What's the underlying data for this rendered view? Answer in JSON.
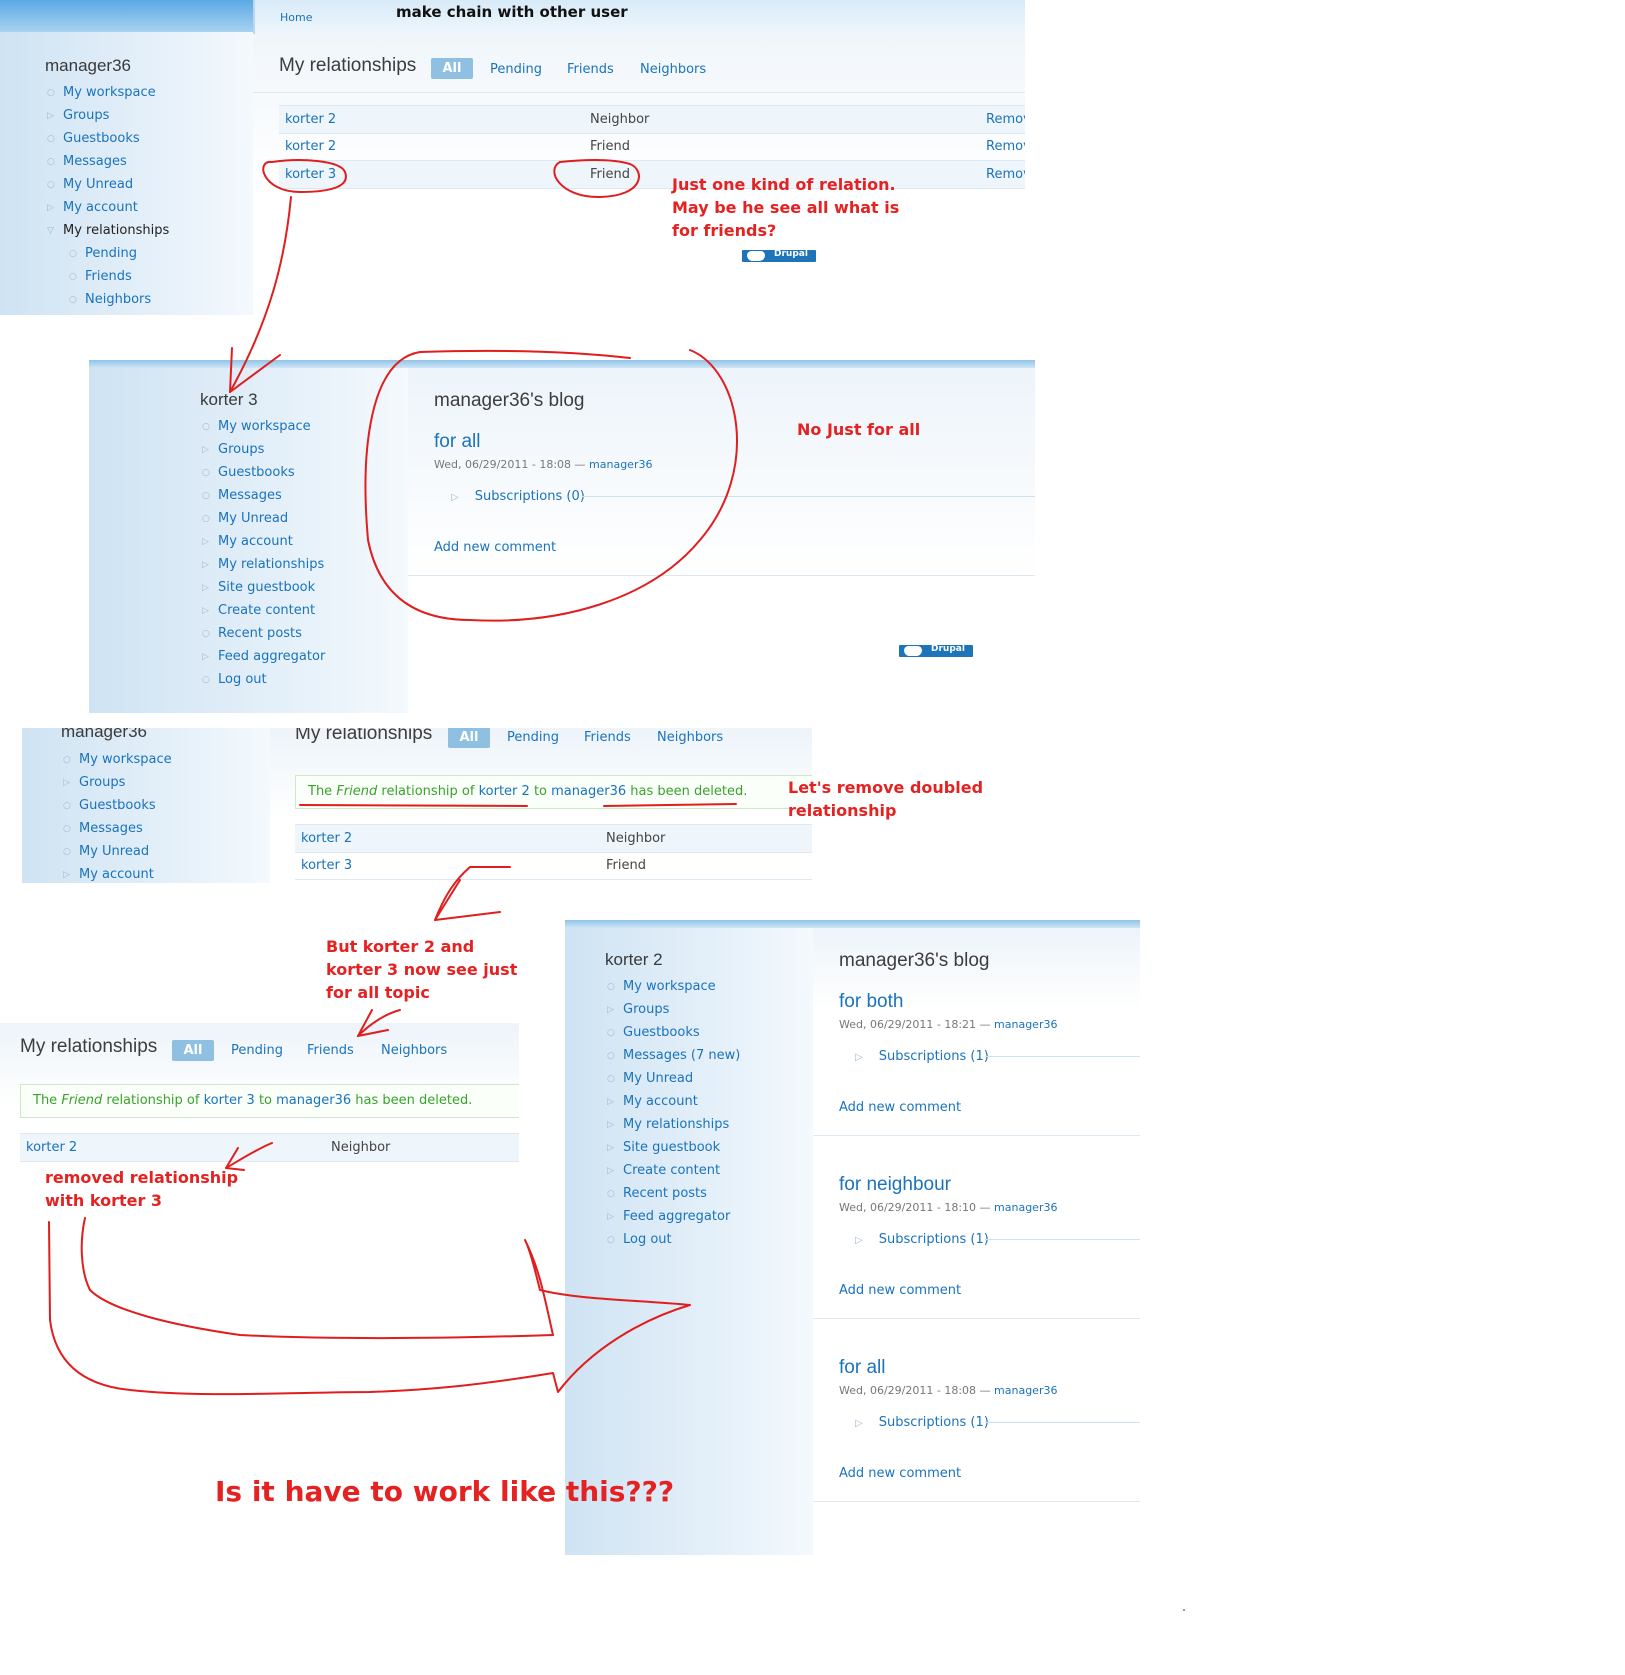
{
  "captions": {
    "top": "make chain with other user"
  },
  "panel1": {
    "breadcrumb": "Home",
    "sidebar_title": "manager36",
    "nav": [
      "My workspace",
      "Groups",
      "Guestbooks",
      "Messages",
      "My Unread",
      "My account",
      "My relationships",
      "Pending",
      "Friends",
      "Neighbors"
    ],
    "page_title": "My relationships",
    "tabs": [
      "All",
      "Pending",
      "Friends",
      "Neighbors"
    ],
    "rows": [
      {
        "user": "korter 2",
        "type": "Neighbor",
        "action": "Remov"
      },
      {
        "user": "korter 2",
        "type": "Friend",
        "action": "Remov"
      },
      {
        "user": "korter 3",
        "type": "Friend",
        "action": "Remov"
      }
    ],
    "badge": "Drupal"
  },
  "panel2": {
    "sidebar_title": "korter 3",
    "nav": [
      "My workspace",
      "Groups",
      "Guestbooks",
      "Messages",
      "My Unread",
      "My account",
      "My relationships",
      "Site guestbook",
      "Create content",
      "Recent posts",
      "Feed aggregator",
      "Log out"
    ],
    "blog_title": "manager36's blog",
    "node": {
      "title": "for all",
      "meta_date": "Wed, 06/29/2011 - 18:08 — ",
      "meta_author": "manager36",
      "subscriptions": "Subscriptions (0)",
      "add_comment": "Add new comment"
    },
    "badge": "Drupal"
  },
  "panel3": {
    "sidebar_title": "manager36",
    "nav": [
      "My workspace",
      "Groups",
      "Guestbooks",
      "Messages",
      "My Unread",
      "My account"
    ],
    "page_title": "My relationships",
    "tabs": [
      "All",
      "Pending",
      "Friends",
      "Neighbors"
    ],
    "message": {
      "p1": "The ",
      "rel": "Friend",
      "p2": " relationship of ",
      "user": "korter 2",
      "p3": " to ",
      "owner": "manager36",
      "p4": " has been deleted."
    },
    "rows": [
      {
        "user": "korter 2",
        "type": "Neighbor"
      },
      {
        "user": "korter 3",
        "type": "Friend"
      }
    ]
  },
  "panel4": {
    "page_title": "My relationships",
    "tabs": [
      "All",
      "Pending",
      "Friends",
      "Neighbors"
    ],
    "message": {
      "p1": "The ",
      "rel": "Friend",
      "p2": " relationship of ",
      "user": "korter 3",
      "p3": " to ",
      "owner": "manager36",
      "p4": " has been deleted."
    },
    "rows": [
      {
        "user": "korter 2",
        "type": "Neighbor"
      }
    ]
  },
  "panel5": {
    "sidebar_title": "korter 2",
    "nav": [
      "My workspace",
      "Groups",
      "Guestbooks",
      "Messages (7 new)",
      "My Unread",
      "My account",
      "My relationships",
      "Site guestbook",
      "Create content",
      "Recent posts",
      "Feed aggregator",
      "Log out"
    ],
    "blog_title": "manager36's blog",
    "nodes": [
      {
        "title": "for both",
        "meta_date": "Wed, 06/29/2011 - 18:21 — ",
        "meta_author": "manager36",
        "subscriptions": "Subscriptions (1)",
        "add_comment": "Add new comment"
      },
      {
        "title": "for neighbour",
        "meta_date": "Wed, 06/29/2011 - 18:10 — ",
        "meta_author": "manager36",
        "subscriptions": "Subscriptions (1)",
        "add_comment": "Add new comment"
      },
      {
        "title": "for all",
        "meta_date": "Wed, 06/29/2011 - 18:08 — ",
        "meta_author": "manager36",
        "subscriptions": "Subscriptions (1)",
        "add_comment": "Add new comment"
      }
    ]
  },
  "notes": {
    "one_kind": [
      "Just one kind of relation.",
      "May be he see all what is",
      "for friends?"
    ],
    "no_just": "No Just for all",
    "remove_doubled": [
      "Let's remove doubled",
      "relationship"
    ],
    "but_korter": [
      "But korter 2 and",
      "korter 3 now see just",
      "for all topic"
    ],
    "removed_rel": [
      "removed relationship",
      "with korter 3"
    ],
    "question": "Is it have to work like this???"
  },
  "colors": {
    "link": "#1a73bd",
    "annotation": "#e42222",
    "status_ok": "#3aa12c",
    "tab_active": "#8fbfe1"
  }
}
